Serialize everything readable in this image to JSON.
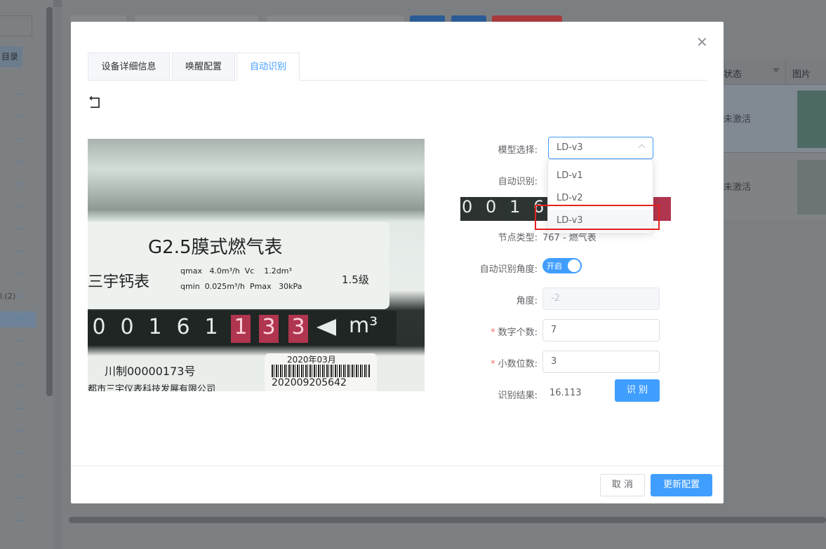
{
  "background": {
    "sidebar_partial_label": "目录",
    "sidebar_count_label": "l.(2)",
    "ellipsis": "···",
    "table_headers": [
      "状态",
      "图片"
    ],
    "table_rows": [
      {
        "status": "未激活"
      },
      {
        "status": "未激活"
      }
    ]
  },
  "modal": {
    "tabs": [
      {
        "label": "设备详细信息"
      },
      {
        "label": "唤醒配置"
      },
      {
        "label": "自动识别"
      }
    ],
    "active_tab": "自动识别",
    "meter_image": {
      "title": "G2.5膜式燃气表",
      "brand": "三宇钙表",
      "spec_line1": "qmax   4.0m³/h  Vc    1.2dm³",
      "spec_line2": "qmin  0.025m³/h  Pmax   30kPa",
      "level": "1.5级",
      "digits": [
        "0",
        "0",
        "1",
        "6",
        "1",
        "1",
        "3",
        "3"
      ],
      "unit": "m³",
      "license": "川制00000173号",
      "barcode_date": "2020年03月",
      "barcode_number": "202009205642",
      "company": "都市三宇仪表科技发展有限公司"
    },
    "form": {
      "model_label": "模型选择:",
      "model_value": "LD-v3",
      "auto_recog_label": "自动识别:",
      "strip_digits": [
        "0",
        "0",
        "1",
        "6"
      ],
      "node_type_label": "节点类型:",
      "node_type_value": "767 - 燃气表",
      "auto_angle_label": "自动识别角度:",
      "auto_angle_switch_text": "开启",
      "auto_angle_on": true,
      "angle_label": "角度:",
      "angle_value": "-2",
      "digit_count_label": "数字个数:",
      "digit_count_value": "7",
      "decimal_label": "小数位数:",
      "decimal_value": "3",
      "result_label": "识别结果:",
      "result_value": "16.113",
      "recognize_button": "识 别"
    },
    "dropdown": {
      "options": [
        "LD-v1",
        "LD-v2",
        "LD-v3"
      ],
      "selected": "LD-v3"
    },
    "footer": {
      "cancel": "取 消",
      "update": "更新配置"
    }
  },
  "colors": {
    "primary": "#409eff",
    "highlight_box": "#e3211e",
    "required": "#f56c6c"
  }
}
